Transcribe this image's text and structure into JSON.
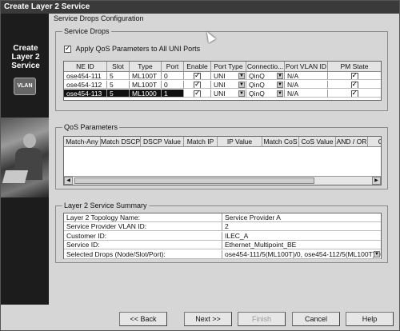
{
  "window": {
    "title": "Create Layer 2 Service"
  },
  "sidebar": {
    "title": "Create\nLayer 2\nService",
    "badge": "VLAN"
  },
  "config_label": "Service Drops Configuration",
  "service_drops": {
    "label": "Service Drops",
    "apply_qos_label": "Apply QoS Parameters to All UNI Ports",
    "apply_qos_checked": true,
    "columns": [
      "NE ID",
      "Slot",
      "Type",
      "Port",
      "Enable",
      "Port Type",
      "Connectio...",
      "Port VLAN ID",
      "PM State"
    ],
    "rows": [
      {
        "ne_id": "ose454-111",
        "slot": "5",
        "type": "ML100T",
        "port": "0",
        "enable": true,
        "port_type": "UNI",
        "connection": "QinQ",
        "port_vlan_id": "N/A",
        "pm_state": true
      },
      {
        "ne_id": "ose454-112",
        "slot": "5",
        "type": "ML100T",
        "port": "0",
        "enable": true,
        "port_type": "UNI",
        "connection": "QinQ",
        "port_vlan_id": "N/A",
        "pm_state": true
      },
      {
        "ne_id": "ose454-113",
        "slot": "5",
        "type": "ML1000",
        "port": "1",
        "enable": true,
        "port_type": "UNI",
        "connection": "QinQ",
        "port_vlan_id": "N/A",
        "pm_state": true
      }
    ]
  },
  "qos": {
    "label": "QoS Parameters",
    "columns": [
      "Match-Any",
      "Match DSCP",
      "DSCP Value",
      "Match IP",
      "IP Value",
      "Match CoS",
      "CoS Value",
      "AND / OR",
      "CIR"
    ]
  },
  "summary": {
    "label": "Layer 2 Service Summary",
    "rows": [
      {
        "key": "Layer 2 Topology Name:",
        "value": "Service Provider A"
      },
      {
        "key": "Service Provider VLAN ID:",
        "value": "2"
      },
      {
        "key": "Customer ID:",
        "value": "ILEC_A"
      },
      {
        "key": "Service ID:",
        "value": "Ethernet_Multipoint_BE"
      },
      {
        "key": "Selected Drops (Node/Slot/Port):",
        "value": "ose454-111/5(ML100T)/0, ose454-112/5(ML100T)/0, o:"
      }
    ]
  },
  "buttons": {
    "back": "<< Back",
    "next": "Next >>",
    "finish": "Finish",
    "cancel": "Cancel",
    "help": "Help"
  }
}
